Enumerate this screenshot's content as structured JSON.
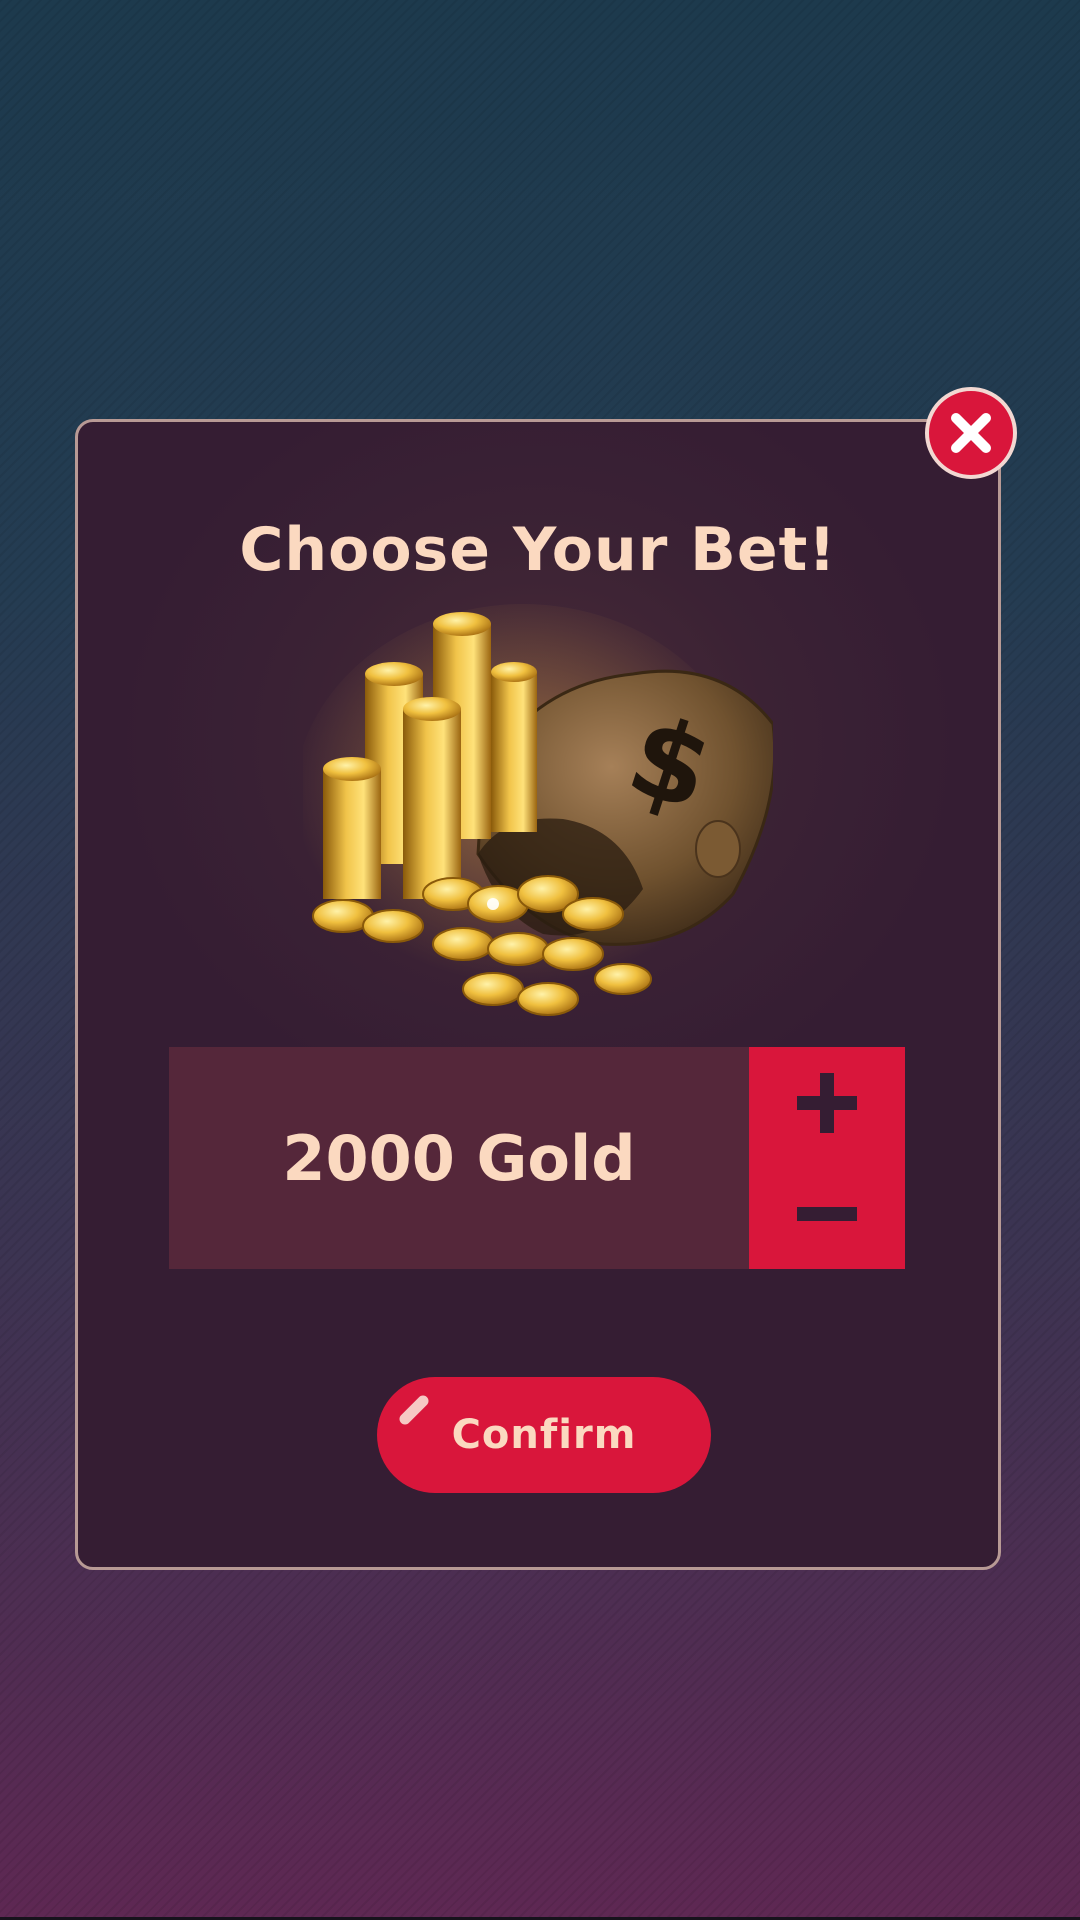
{
  "dialog": {
    "title": "Choose Your Bet!",
    "close_icon": "close-x-icon",
    "image": "gold-coins-and-money-bag",
    "bet": {
      "amount": 2000,
      "value_text": "2000 Gold",
      "increase_icon": "plus-icon",
      "decrease_icon": "minus-icon"
    },
    "confirm_label": "Confirm"
  },
  "colors": {
    "accent": "#d9163b",
    "text": "#fbd9c0",
    "panel": "#351d33",
    "field": "#55273a"
  }
}
